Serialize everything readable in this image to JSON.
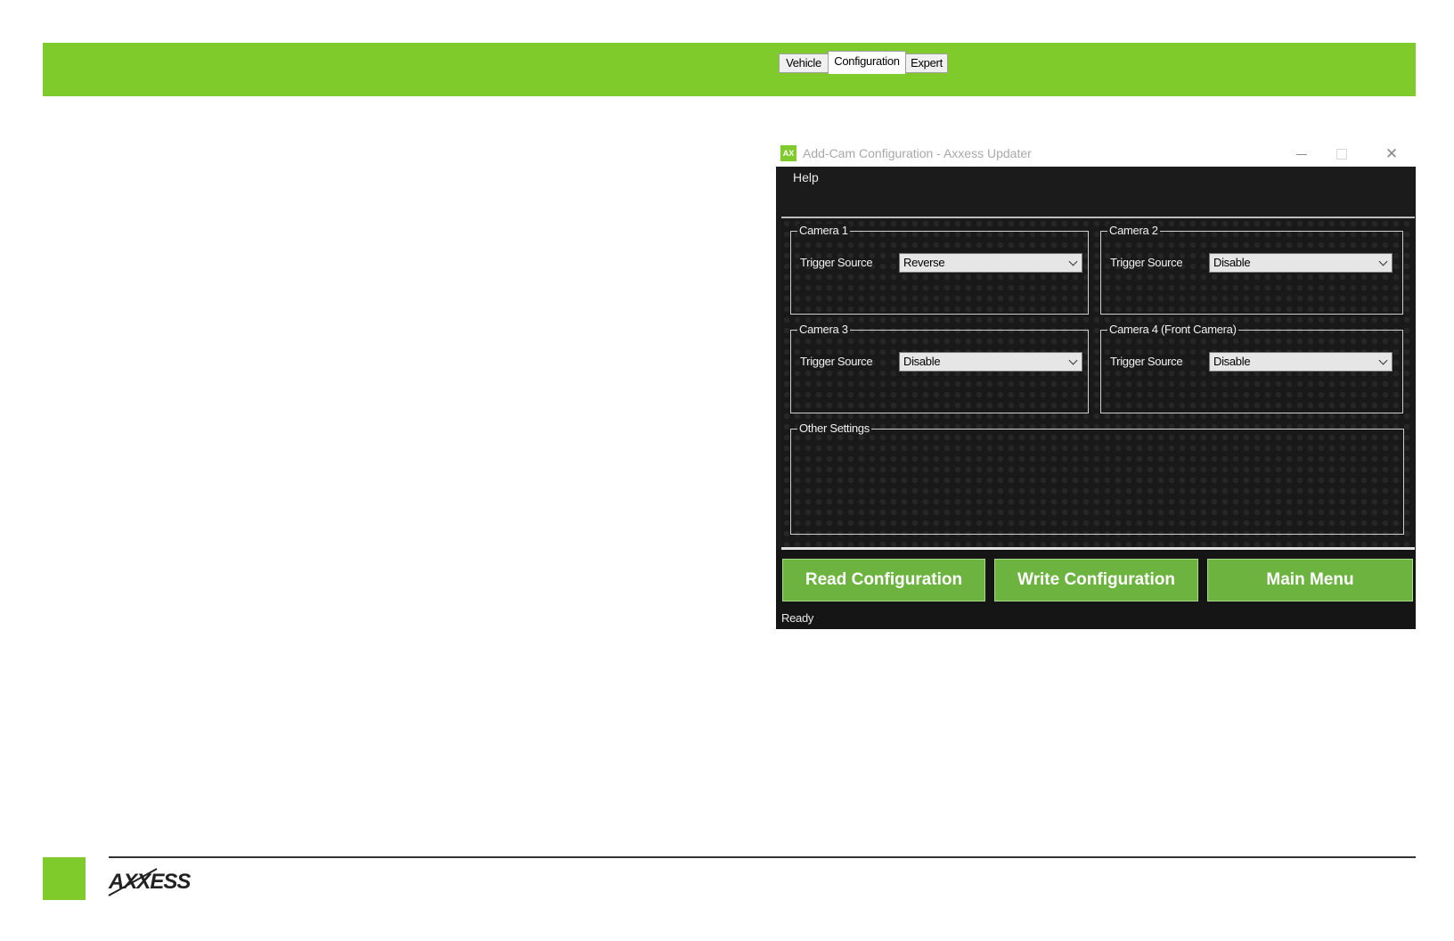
{
  "window": {
    "app_icon_text": "AX",
    "title": "Add-Cam Configuration - Axxess Updater"
  },
  "menu": {
    "help": "Help"
  },
  "tabs": {
    "vehicle": "Vehicle",
    "configuration": "Configuration",
    "expert": "Expert",
    "active": "Configuration"
  },
  "cameras": [
    {
      "title": "Camera 1",
      "trigger_label": "Trigger Source",
      "trigger_value": "Reverse"
    },
    {
      "title": "Camera 2",
      "trigger_label": "Trigger Source",
      "trigger_value": "Disable"
    },
    {
      "title": "Camera 3",
      "trigger_label": "Trigger Source",
      "trigger_value": "Disable"
    },
    {
      "title": "Camera 4 (Front Camera)",
      "trigger_label": "Trigger Source",
      "trigger_value": "Disable"
    }
  ],
  "other_settings": {
    "title": "Other Settings"
  },
  "buttons": {
    "read": "Read Configuration",
    "write": "Write Configuration",
    "main_menu": "Main Menu"
  },
  "status": "Ready",
  "brand": {
    "logo_text": "AXXESS"
  },
  "colors": {
    "brand_green": "#7ecb2b",
    "button_green": "#6cb33f",
    "window_dark": "#1b1b1b"
  },
  "icons": [
    "minimize-icon",
    "maximize-icon",
    "close-icon",
    "chevron-down-icon"
  ]
}
